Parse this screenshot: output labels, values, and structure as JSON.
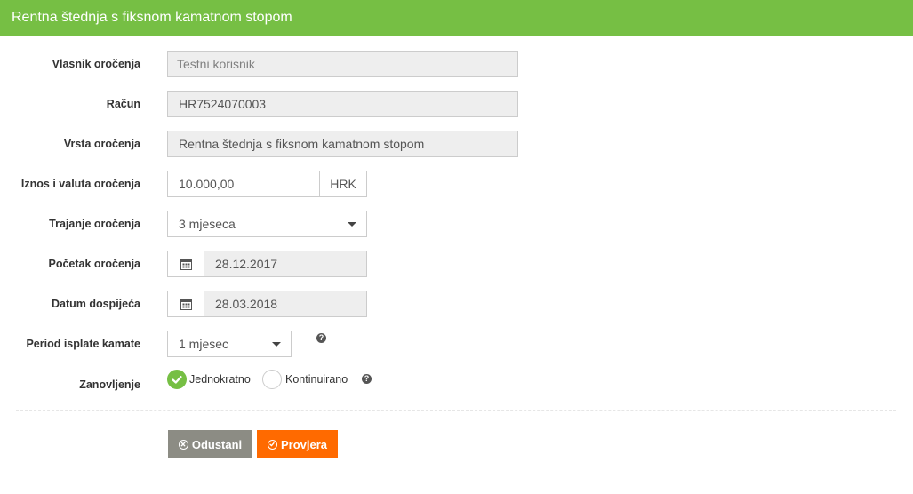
{
  "header": {
    "title": "Rentna štednja s fiksnom kamatnom stopom"
  },
  "form": {
    "owner": {
      "label": "Vlasnik oročenja",
      "value": "Testni korisnik"
    },
    "account": {
      "label": "Račun",
      "value": "HR7524070003"
    },
    "type": {
      "label": "Vrsta oročenja",
      "value": "Rentna štednja s fiksnom kamatnom stopom"
    },
    "amount": {
      "label": "Iznos i valuta oročenja",
      "value": "10.000,00",
      "currency": "HRK"
    },
    "duration": {
      "label": "Trajanje oročenja",
      "selected": "3 mjeseca"
    },
    "start": {
      "label": "Početak oročenja",
      "value": "28.12.2017"
    },
    "maturity": {
      "label": "Datum dospijeća",
      "value": "28.03.2018"
    },
    "interest_period": {
      "label": "Period isplate kamate",
      "selected": "1 mjesec"
    },
    "renewal": {
      "label": "Zanovljenje",
      "options": [
        "Jednokratno",
        "Kontinuirano"
      ],
      "selected": "Jednokratno"
    }
  },
  "buttons": {
    "cancel": "Odustani",
    "check": "Provjera"
  },
  "icons": {
    "calendar": "calendar-icon",
    "help": "help-icon",
    "check": "check-icon",
    "cancel": "cancel-circle-icon",
    "check_circle": "check-circle-icon"
  },
  "colors": {
    "header_bg": "#76bf44",
    "radio_checked": "#76bf44",
    "cancel_button": "#8c8c84",
    "check_button": "#ff6a00"
  }
}
